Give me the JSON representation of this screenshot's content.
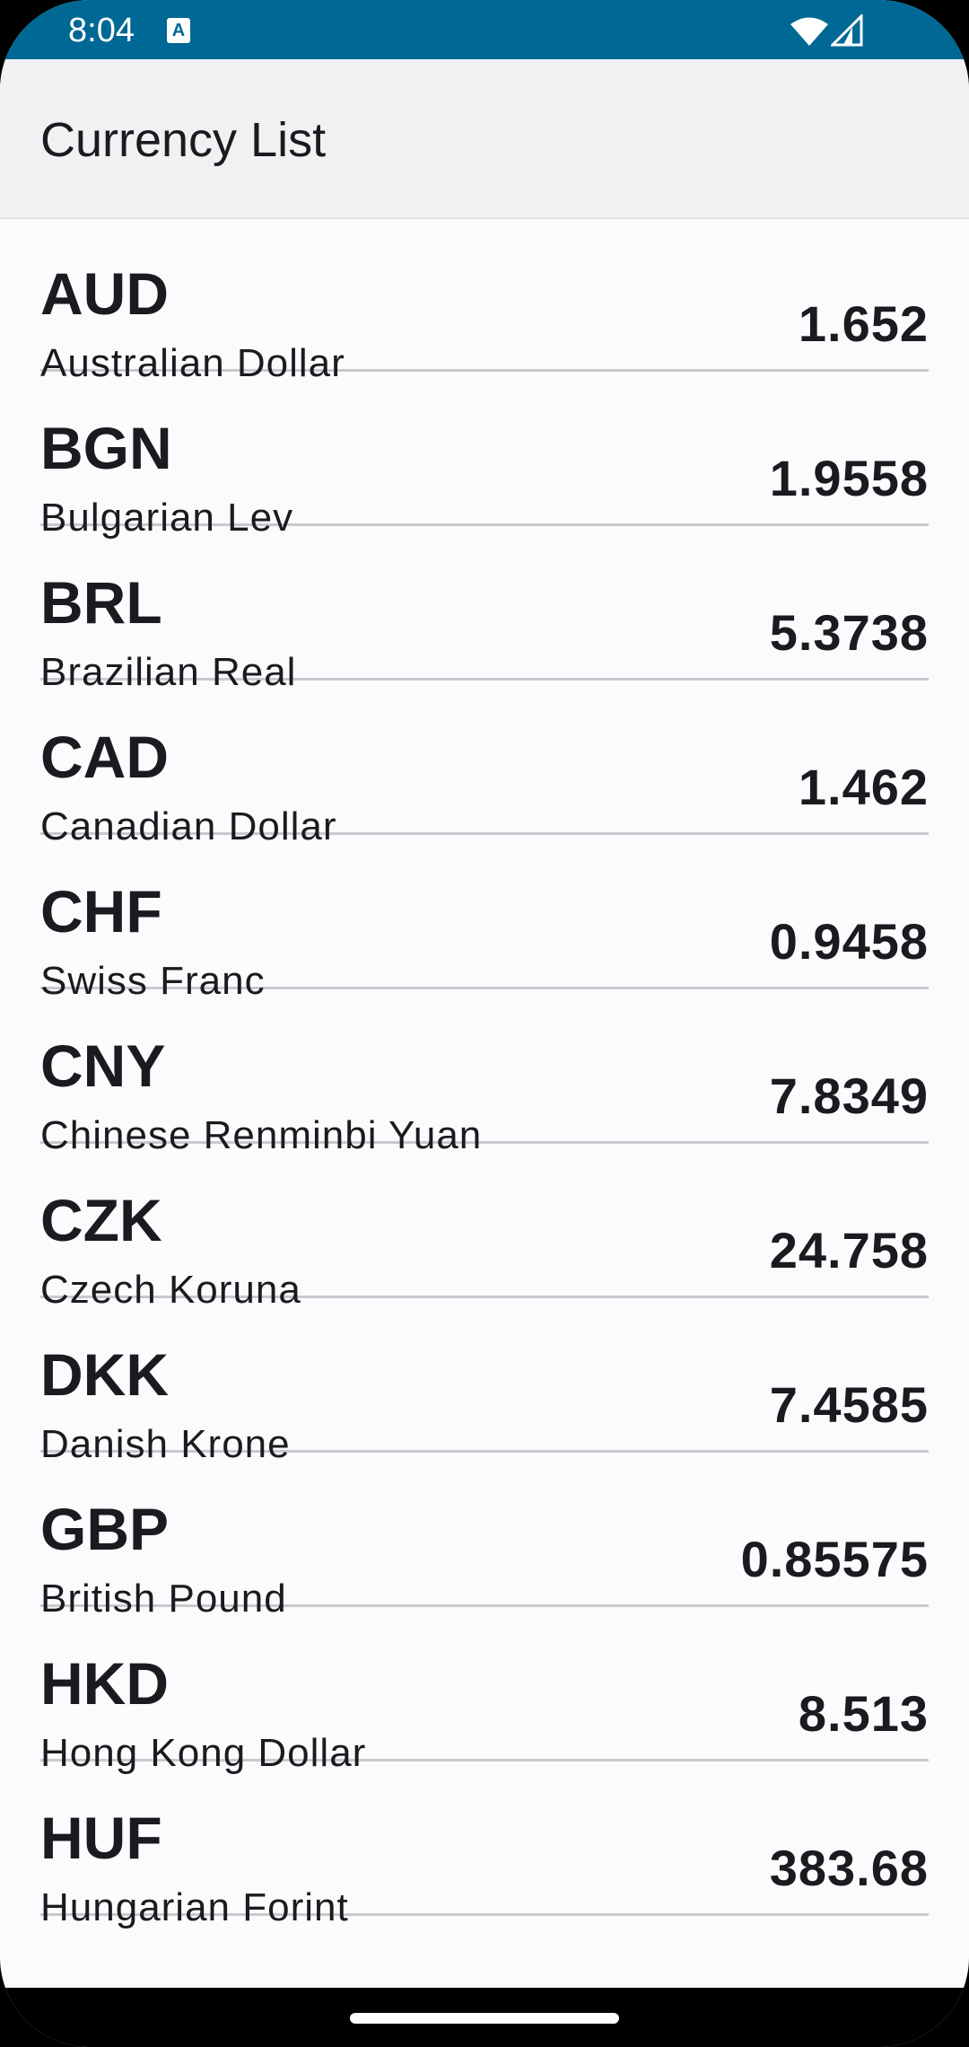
{
  "status_bar": {
    "time": "8:04",
    "notification_icon": "accessibility-notification-icon",
    "wifi_icon": "wifi-icon",
    "signal_icon": "cell-signal-icon",
    "color": "#006894"
  },
  "app_bar": {
    "title": "Currency List"
  },
  "currencies": [
    {
      "code": "AUD",
      "name": "Australian Dollar",
      "rate": "1.652"
    },
    {
      "code": "BGN",
      "name": "Bulgarian Lev",
      "rate": "1.9558"
    },
    {
      "code": "BRL",
      "name": "Brazilian Real",
      "rate": "5.3738"
    },
    {
      "code": "CAD",
      "name": "Canadian Dollar",
      "rate": "1.462"
    },
    {
      "code": "CHF",
      "name": "Swiss Franc",
      "rate": "0.9458"
    },
    {
      "code": "CNY",
      "name": "Chinese Renminbi Yuan",
      "rate": "7.8349"
    },
    {
      "code": "CZK",
      "name": "Czech Koruna",
      "rate": "24.758"
    },
    {
      "code": "DKK",
      "name": "Danish Krone",
      "rate": "7.4585"
    },
    {
      "code": "GBP",
      "name": "British Pound",
      "rate": "0.85575"
    },
    {
      "code": "HKD",
      "name": "Hong Kong Dollar",
      "rate": "8.513"
    },
    {
      "code": "HUF",
      "name": "Hungarian Forint",
      "rate": "383.68"
    }
  ]
}
